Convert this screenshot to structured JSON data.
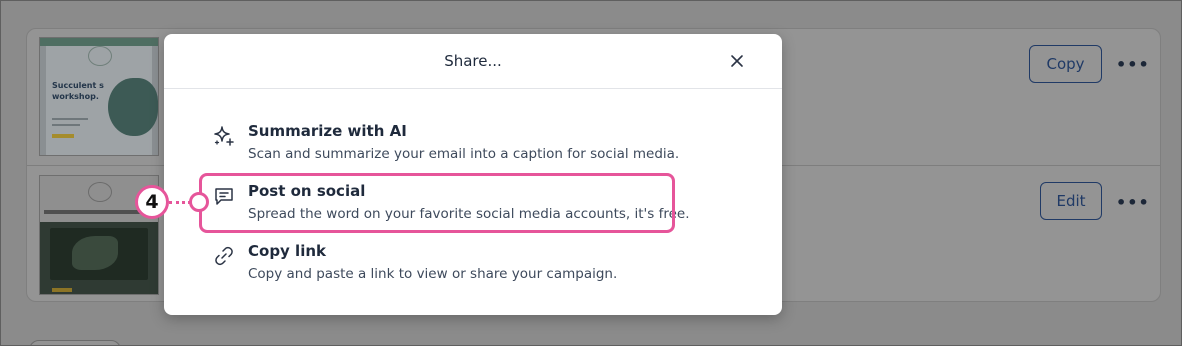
{
  "background": {
    "thumbnail_1": {
      "headline": "Succulent s workshop."
    },
    "buttons": {
      "copy_label": "Copy",
      "edit_label": "Edit"
    },
    "more_icon": "more-horizontal-icon"
  },
  "modal": {
    "title": "Share...",
    "close_icon": "close-icon",
    "options": [
      {
        "title": "Summarize with AI",
        "description": "Scan and summarize your email into a caption for social media.",
        "icon": "sparkle-icon"
      },
      {
        "title": "Post on social",
        "description": "Spread the word on your favorite social media accounts, it's free.",
        "icon": "chat-bubble-icon"
      },
      {
        "title": "Copy link",
        "description": "Copy and paste a link to view or share your campaign.",
        "icon": "link-icon"
      }
    ]
  },
  "callout": {
    "step_number": "4",
    "color": "#e6559a"
  },
  "colors": {
    "overlay": "#8b8b8b",
    "button_outline": "#203a66",
    "highlight": "#e6559a"
  }
}
